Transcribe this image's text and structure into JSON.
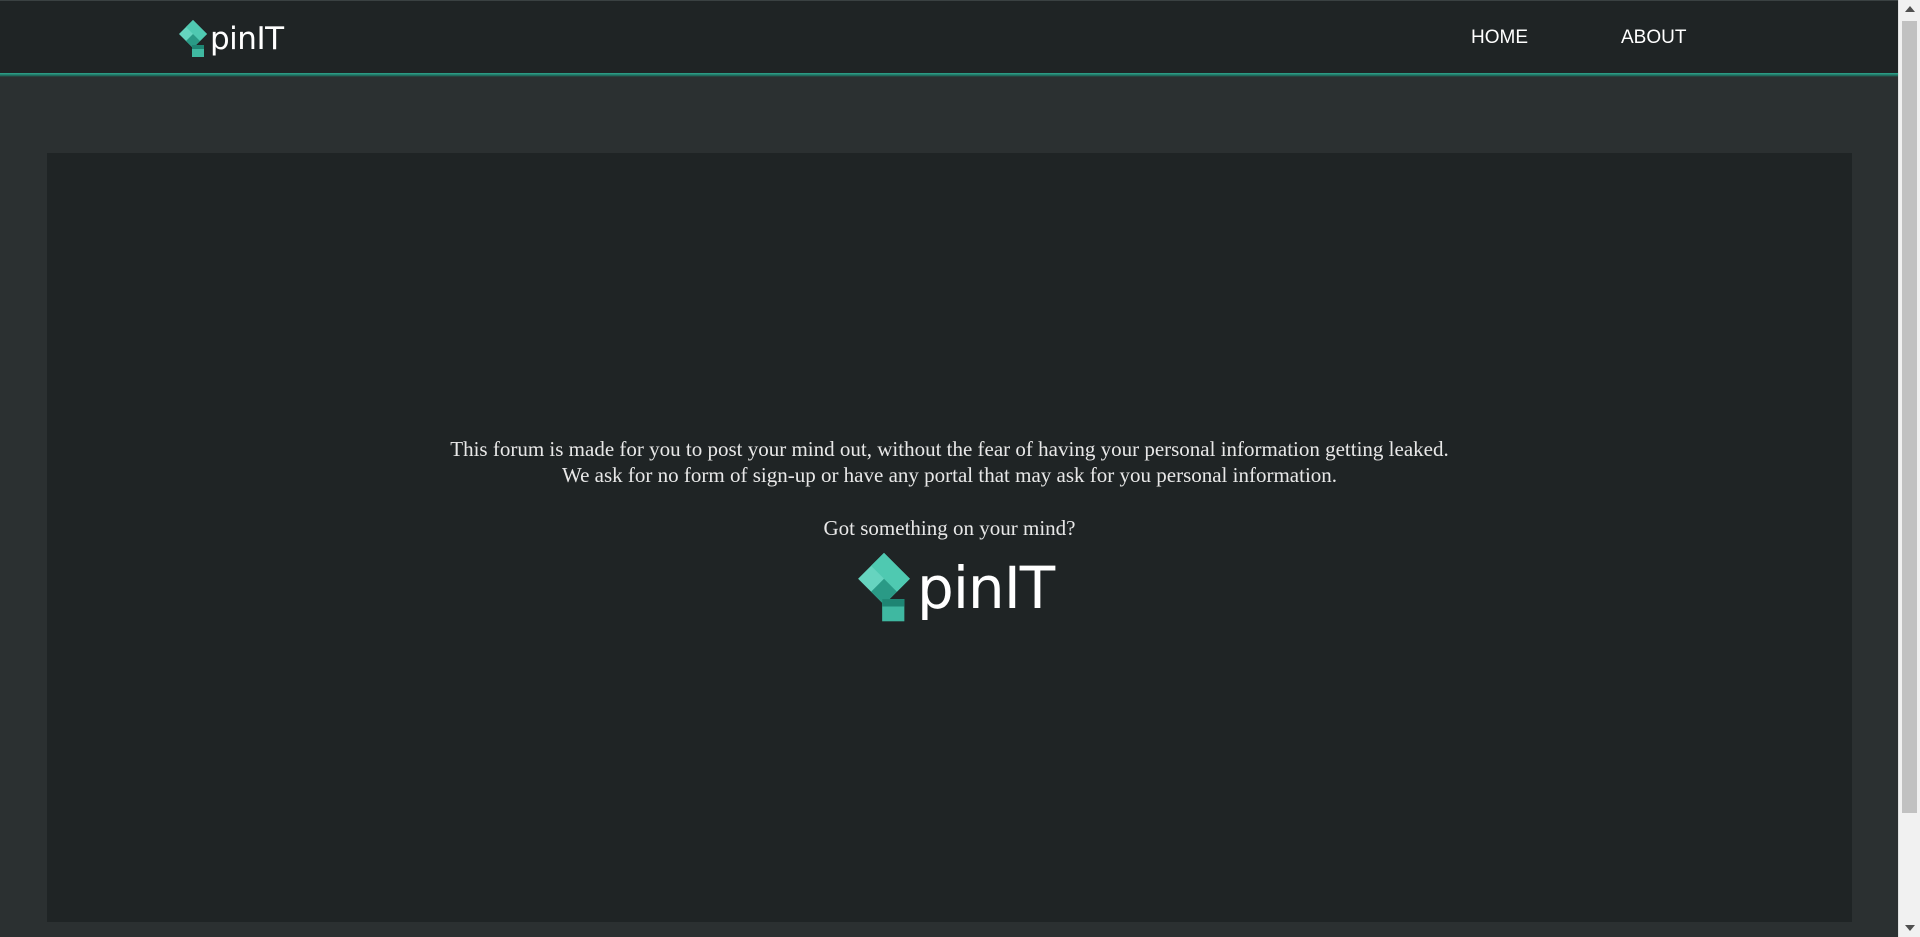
{
  "nav": {
    "brand_text": "pinIT",
    "links": [
      {
        "label": "HOME"
      },
      {
        "label": "ABOUT"
      }
    ]
  },
  "main": {
    "intro_line_1": "This forum is made for you to post your mind out, without the fear of having your personal information getting leaked.",
    "intro_line_2": "We ask for no form of sign-up or have any portal that may ask for you personal information.",
    "prompt": "Got something on your mind?",
    "logo_text": "pinIT"
  },
  "colors": {
    "background": "#2b3031",
    "panel": "#1f2425",
    "accent": "#2fa58d",
    "logo_light": "#66d4bf",
    "logo_mid": "#3fb8a1",
    "logo_dark": "#1e8573"
  },
  "icons": {
    "brand_icon": "pin-arrow-logo-icon"
  }
}
